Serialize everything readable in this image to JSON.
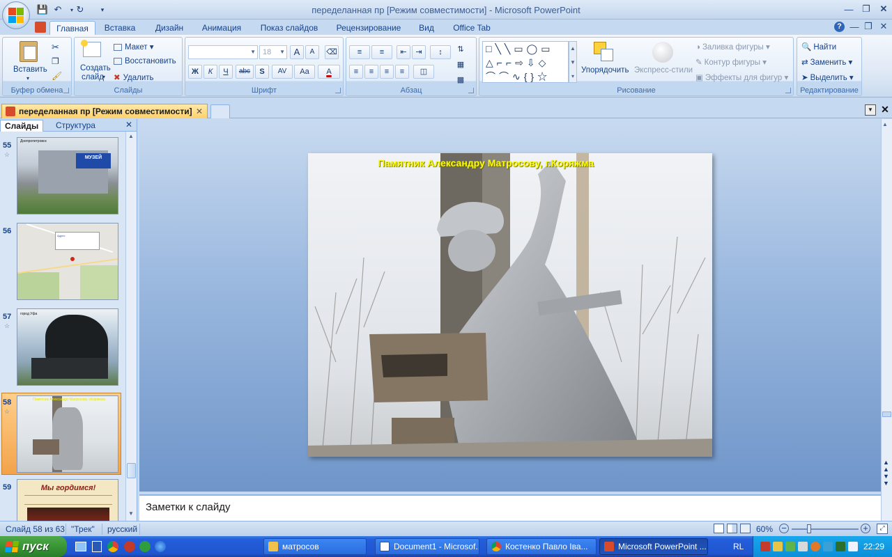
{
  "window": {
    "title": "переделанная пр [Режим совместимости] - Microsoft PowerPoint"
  },
  "ribbon_tabs": [
    "Главная",
    "Вставка",
    "Дизайн",
    "Анимация",
    "Показ слайдов",
    "Рецензирование",
    "Вид",
    "Office Tab"
  ],
  "ribbon": {
    "clipboard": {
      "label": "Буфер обмена",
      "paste": "Вставить"
    },
    "slides": {
      "label": "Слайды",
      "create": "Создать",
      "create2": "слайд",
      "layout": "Макет",
      "reset": "Восстановить",
      "delete": "Удалить"
    },
    "font": {
      "label": "Шрифт",
      "size": "18",
      "bold": "Ж",
      "italic": "К",
      "underline": "Ч",
      "strike": "abc",
      "shadow": "S",
      "spacing": "AV",
      "case": "Aa",
      "color": "A",
      "grow": "A",
      "shrink": "A"
    },
    "paragraph": {
      "label": "Абзац"
    },
    "drawing": {
      "label": "Рисование",
      "arrange": "Упорядочить",
      "quick_styles": "Экспресс-стили",
      "fill": "Заливка фигуры",
      "outline": "Контур фигуры",
      "effects": "Эффекты для фигур"
    },
    "editing": {
      "label": "Редактирование",
      "find": "Найти",
      "replace": "Заменить",
      "select": "Выделить"
    }
  },
  "doc_tab": {
    "label": "переделанная пр [Режим совместимости]"
  },
  "slide_pane": {
    "tab_slides": "Слайды",
    "tab_outline": "Структура",
    "thumbs": [
      {
        "num": "55",
        "caption": "Днепропетровск",
        "sign": "МУЗЕЙ"
      },
      {
        "num": "56",
        "caption": "Адрес"
      },
      {
        "num": "57",
        "caption": "город Уфа"
      },
      {
        "num": "58",
        "caption": "Памятник Александру Матросову, г.Коряжма"
      },
      {
        "num": "59",
        "caption": "Мы гордимся!"
      }
    ]
  },
  "slide": {
    "caption": "Памятник Александру Матросову, г.Коряжма"
  },
  "notes": {
    "placeholder": "Заметки к слайду"
  },
  "status": {
    "slide": "Слайд 58 из 63",
    "theme": "\"Трек\"",
    "lang": "русский",
    "zoom": "60%"
  },
  "taskbar": {
    "start": "пуск",
    "tasks": [
      "матросов",
      "Document1 - Microsof...",
      "Костенко Павло Іва...",
      "Microsoft PowerPoint ..."
    ],
    "lang": "RL",
    "clock": "22:29"
  },
  "colors": {
    "ribbon_bg": "#dfe9f5",
    "active_doc_tab": "#ffd06b",
    "slide_caption": "#ffff00",
    "taskbar": "#245edb",
    "start": "#3c9a39"
  }
}
